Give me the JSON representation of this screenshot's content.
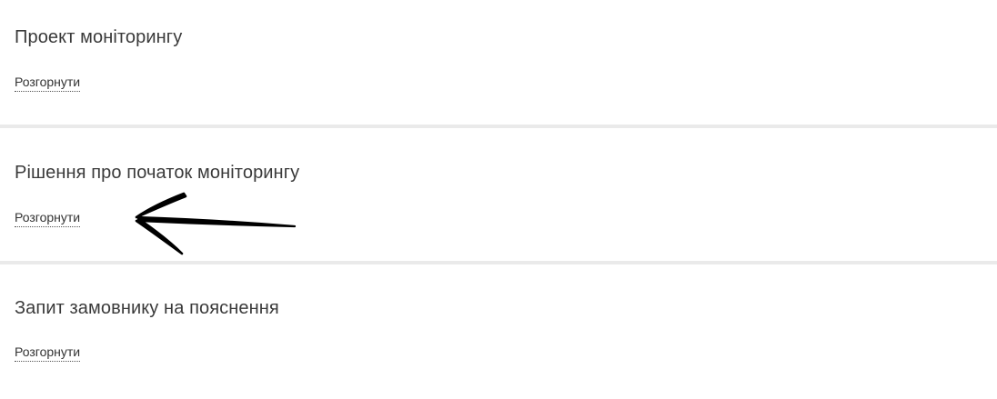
{
  "sections": [
    {
      "title": "Проект моніторингу",
      "toggle_label": "Розгорнути"
    },
    {
      "title": "Рішення про початок моніторингу",
      "toggle_label": "Розгорнути"
    },
    {
      "title": "Запит замовнику на пояснення",
      "toggle_label": "Розгорнути"
    }
  ],
  "annotation": {
    "icon": "hand-drawn-arrow-icon",
    "color": "#000000"
  },
  "colors": {
    "background": "#ffffff",
    "divider": "#eaeaea",
    "text": "#3a3a3a"
  }
}
